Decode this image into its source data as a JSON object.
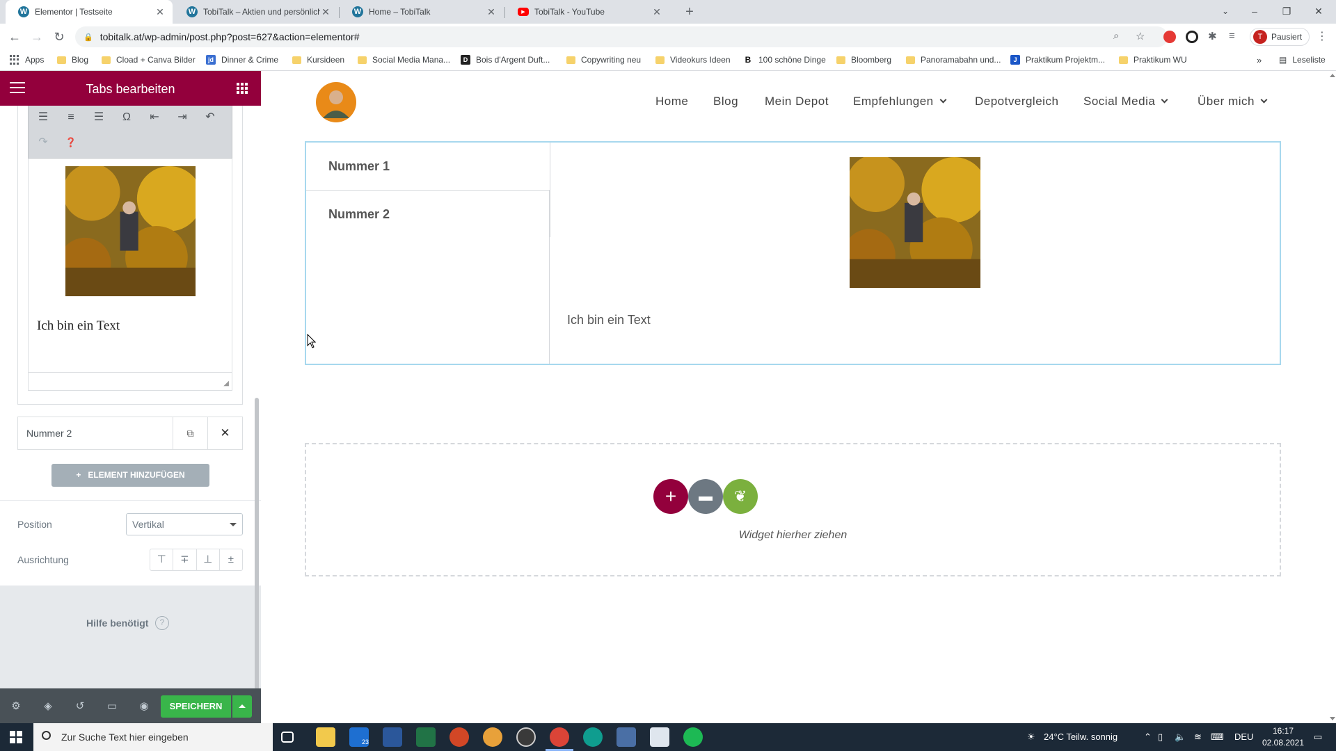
{
  "browser": {
    "tabs": [
      {
        "label": "Elementor | Testseite",
        "active": true
      },
      {
        "label": "TobiTalk – Aktien und persönliche",
        "active": false
      },
      {
        "label": "Home – TobiTalk",
        "active": false
      },
      {
        "label": "TobiTalk - YouTube",
        "active": false
      }
    ],
    "url": "tobitalk.at/wp-admin/post.php?post=627&action=elementor#",
    "profile_status": "Pausiert",
    "profile_initial": "T",
    "bookmarks": [
      "Apps",
      "Blog",
      "Cload + Canva Bilder",
      "Dinner & Crime",
      "Kursideen",
      "Social Media Mana...",
      "Bois d'Argent Duft...",
      "Copywriting neu",
      "Videokurs Ideen",
      "100 schöne Dinge",
      "Bloomberg",
      "Panoramabahn und...",
      "Praktikum Projektm...",
      "Praktikum WU"
    ],
    "reading_list": "Leseliste"
  },
  "panel": {
    "title": "Tabs bearbeiten",
    "editor_text": "Ich bin ein Text",
    "repeater_item_label": "Nummer 2",
    "add_element_label": "ELEMENT HINZUFÜGEN",
    "position_label": "Position",
    "position_value": "Vertikal",
    "alignment_label": "Ausrichtung",
    "help_label": "Hilfe benötigt",
    "save_label": "SPEICHERN"
  },
  "site": {
    "nav": [
      "Home",
      "Blog",
      "Mein Depot",
      "Empfehlungen",
      "Depotvergleich",
      "Social Media",
      "Über mich"
    ],
    "tabs": [
      "Nummer 1",
      "Nummer 2"
    ],
    "tab_content_text": "Ich bin ein Text",
    "drop_label": "Widget hierher ziehen"
  },
  "taskbar": {
    "search_placeholder": "Zur Suche Text hier eingeben",
    "weather": "24°C  Teilw. sonnig",
    "language": "DEU",
    "time": "16:17",
    "date": "02.08.2021",
    "mail_badge": "23"
  },
  "colors": {
    "elementor_brand": "#93003c",
    "save_green": "#39b54a",
    "selection_blue": "#a7d8ee"
  }
}
